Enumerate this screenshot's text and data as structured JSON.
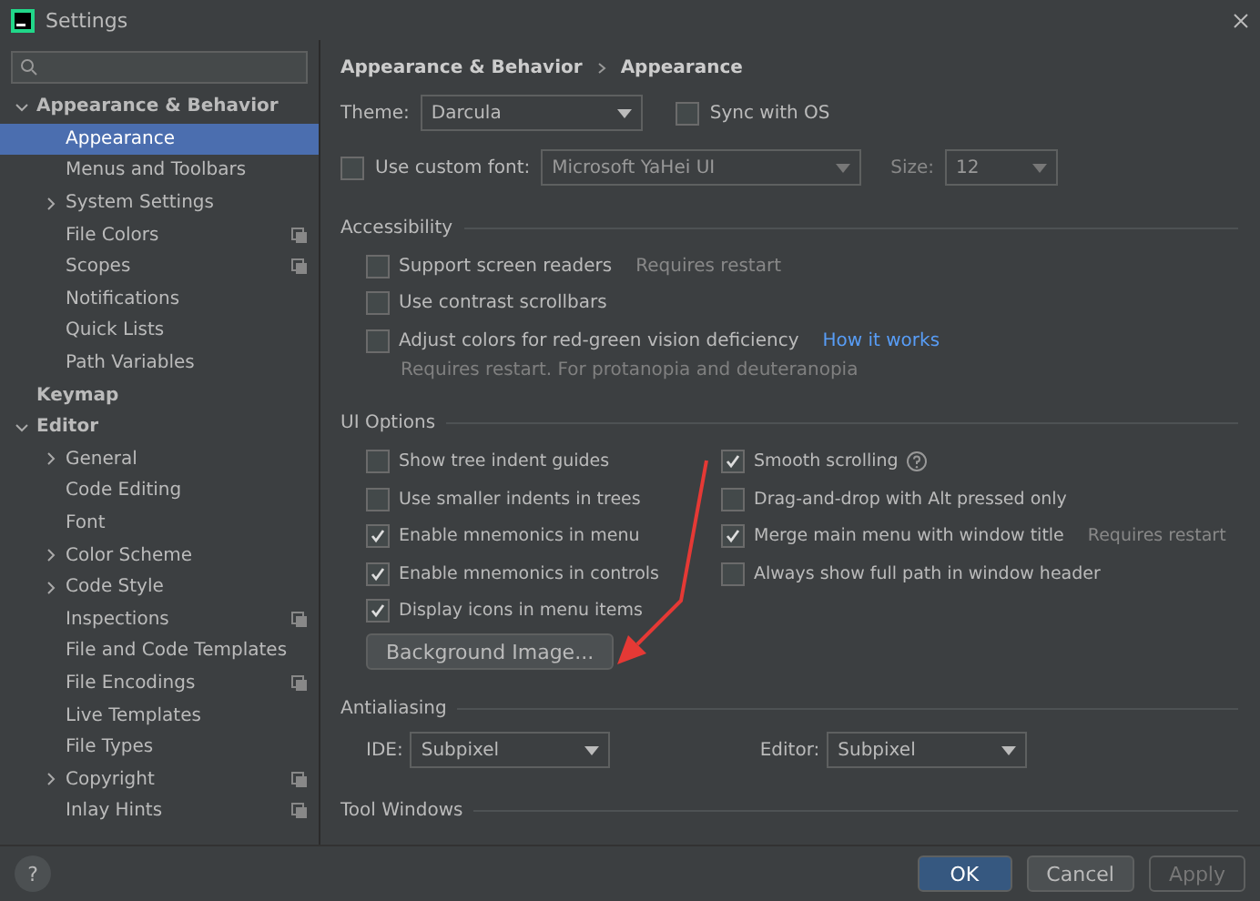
{
  "window": {
    "title": "Settings"
  },
  "sidebar": {
    "items": [
      {
        "label": "Appearance & Behavior",
        "bold": true,
        "expanded": true,
        "selected": false,
        "children": [
          {
            "label": "Appearance",
            "selected": true,
            "project_icon": false
          },
          {
            "label": "Menus and Toolbars",
            "selected": false,
            "project_icon": false
          },
          {
            "label": "System Settings",
            "selected": false,
            "expanded": false,
            "project_icon": false
          },
          {
            "label": "File Colors",
            "selected": false,
            "project_icon": true
          },
          {
            "label": "Scopes",
            "selected": false,
            "project_icon": true
          },
          {
            "label": "Notifications",
            "selected": false,
            "project_icon": false
          },
          {
            "label": "Quick Lists",
            "selected": false,
            "project_icon": false
          },
          {
            "label": "Path Variables",
            "selected": false,
            "project_icon": false
          }
        ]
      },
      {
        "label": "Keymap",
        "bold": true,
        "selected": false
      },
      {
        "label": "Editor",
        "bold": true,
        "expanded": true,
        "selected": false,
        "children": [
          {
            "label": "General",
            "selected": false,
            "expanded": false,
            "project_icon": false
          },
          {
            "label": "Code Editing",
            "selected": false,
            "project_icon": false
          },
          {
            "label": "Font",
            "selected": false,
            "project_icon": false
          },
          {
            "label": "Color Scheme",
            "selected": false,
            "expanded": false,
            "project_icon": false
          },
          {
            "label": "Code Style",
            "selected": false,
            "expanded": false,
            "project_icon": false
          },
          {
            "label": "Inspections",
            "selected": false,
            "project_icon": true
          },
          {
            "label": "File and Code Templates",
            "selected": false,
            "project_icon": false
          },
          {
            "label": "File Encodings",
            "selected": false,
            "project_icon": true
          },
          {
            "label": "Live Templates",
            "selected": false,
            "project_icon": false
          },
          {
            "label": "File Types",
            "selected": false,
            "project_icon": false
          },
          {
            "label": "Copyright",
            "selected": false,
            "expanded": false,
            "project_icon": true
          },
          {
            "label": "Inlay Hints",
            "selected": false,
            "project_icon": true
          }
        ]
      }
    ]
  },
  "breadcrumb": [
    "Appearance & Behavior",
    "Appearance"
  ],
  "theme": {
    "label": "Theme:",
    "value": "Darcula",
    "sync": {
      "label": "Sync with OS",
      "checked": false
    }
  },
  "custom_font": {
    "label": "Use custom font:",
    "checked": false,
    "value": "Microsoft YaHei UI",
    "size_label": "Size:",
    "size": "12"
  },
  "sections": [
    {
      "title": "Accessibility",
      "options": [
        {
          "label": "Support screen readers",
          "checked": false,
          "note": "Requires restart"
        },
        {
          "label": "Use contrast scrollbars",
          "checked": false
        },
        {
          "label": "Adjust colors for red-green vision deficiency",
          "checked": false,
          "link": "How it works",
          "hint": "Requires restart. For protanopia and deuteranopia"
        }
      ]
    },
    {
      "title": "UI Options",
      "left": [
        {
          "label": "Show tree indent guides",
          "checked": false
        },
        {
          "label": "Use smaller indents in trees",
          "checked": false
        },
        {
          "label": "Enable mnemonics in menu",
          "checked": true
        },
        {
          "label": "Enable mnemonics in controls",
          "checked": true
        },
        {
          "label": "Display icons in menu items",
          "checked": true
        }
      ],
      "right": [
        {
          "label": "Smooth scrolling",
          "checked": true,
          "help": true
        },
        {
          "label": "Drag-and-drop with Alt pressed only",
          "checked": false
        },
        {
          "label": "Merge main menu with window title",
          "checked": true,
          "note": "Requires restart"
        },
        {
          "label": "Always show full path in window header",
          "checked": false
        }
      ],
      "button": "Background Image..."
    },
    {
      "title": "Antialiasing",
      "selects": [
        {
          "label": "IDE:",
          "value": "Subpixel"
        },
        {
          "label": "Editor:",
          "value": "Subpixel"
        }
      ]
    },
    {
      "title": "Tool Windows"
    }
  ],
  "footer": {
    "help": "?",
    "buttons": [
      {
        "label": "OK",
        "kind": "primary"
      },
      {
        "label": "Cancel",
        "kind": "normal"
      },
      {
        "label": "Apply",
        "kind": "disabled"
      }
    ]
  }
}
